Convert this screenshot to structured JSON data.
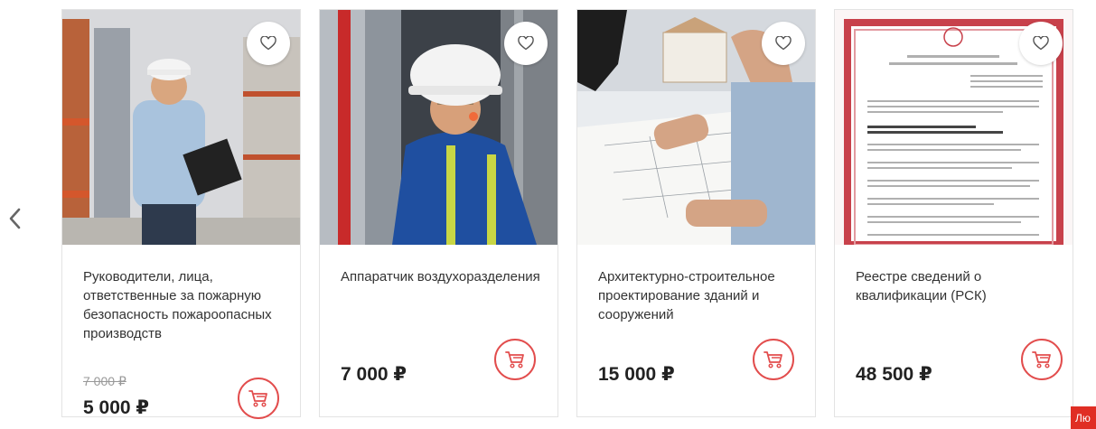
{
  "nav": {
    "prev_icon": "chevron-left-icon"
  },
  "cards": [
    {
      "title": "Руководители, лица, ответственные за пожарную безопасность пожароопасных производств",
      "old_price": "7 000 ₽",
      "price": "5 000 ₽"
    },
    {
      "title": "Аппаратчик воздухоразделения",
      "price": "7 000 ₽"
    },
    {
      "title": "Архитектурно-строительное проектирование зданий и сооружений",
      "price": "15 000 ₽"
    },
    {
      "title": "Реестре сведений о квалификации (РСК)",
      "price": "48 500 ₽"
    }
  ],
  "chat": {
    "label": "Лю"
  },
  "colors": {
    "accent": "#e24d4d",
    "chat": "#e02e24"
  }
}
